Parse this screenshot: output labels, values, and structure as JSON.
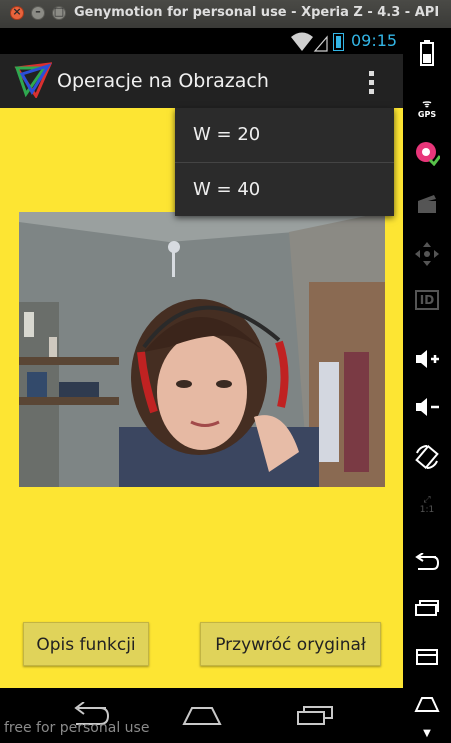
{
  "window": {
    "title": "Genymotion for personal use - Xperia Z - 4.3 - API"
  },
  "status_bar": {
    "time": "09:15"
  },
  "action_bar": {
    "title": "Operacje na Obrazach"
  },
  "overflow_menu": {
    "items": [
      "W = 20",
      "W = 40"
    ]
  },
  "buttons": {
    "left": "Opis funkcji",
    "right": "Przywróć oryginał"
  },
  "watermark": "free for personal use",
  "sidebar": {
    "gps_label": "GPS",
    "id_label": "ID",
    "scale_label": "1:1"
  },
  "colors": {
    "content_bg": "#fde533",
    "accent": "#33b5e5",
    "button_bg": "#e0d35a"
  }
}
